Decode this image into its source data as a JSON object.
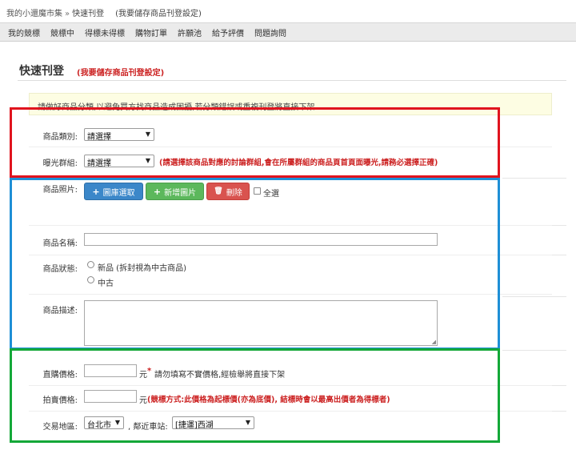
{
  "breadcrumb": {
    "home": "我的小還魔市集",
    "separator": "»",
    "current": "快速刊登",
    "sub": "(我要儲存商品刊登設定)"
  },
  "nav": {
    "items": [
      "我的競標",
      "競標中",
      "得標未得標",
      "購物訂單",
      "許願池",
      "給予評價",
      "問題詢問"
    ]
  },
  "page": {
    "title": "快速刊登",
    "subtitle": "(我要儲存商品刊登設定)",
    "notice": "請做好商品分類,以避免買方找商品造成困擾,若分類錯誤或重複刊登將直接下架"
  },
  "category": {
    "label": "商品類別:",
    "value": "請選擇"
  },
  "exposure": {
    "label": "曝光群組:",
    "value": "請選擇",
    "hint": "(請選擇該商品對應的討論群組,會在所屬群組的商品頁首頁面曝光,請務必選擇正確)"
  },
  "photos": {
    "label": "商品照片:",
    "gallery_button": "圖庫選取",
    "add_button": "新增圖片",
    "delete_button": "刪除",
    "select_all": "全選"
  },
  "name": {
    "label": "商品名稱:",
    "value": ""
  },
  "condition": {
    "label": "商品狀態:",
    "option_new": "新品 (拆封視為中古商品)",
    "option_used": "中古"
  },
  "description": {
    "label": "商品描述:",
    "value": ""
  },
  "buy_price": {
    "label": "直購價格:",
    "unit": "元",
    "asterisk": "*",
    "hint": "請勿填寫不實價格,經檢舉將直接下架"
  },
  "auction_price": {
    "label": "拍賣價格:",
    "unit": "元",
    "hint": "(競標方式:此價格為起標價(亦為底價), 結標時會以最高出價者為得標者)"
  },
  "location": {
    "label": "交易地區:",
    "city": "台北市",
    "station_label": ", 鄰近車站:",
    "station": "[捷運]西湖"
  },
  "icons": {
    "plus": "+",
    "trash": "🗑",
    "caret": "▼",
    "grip": "◢"
  },
  "colors": {
    "red_highlight": "#e0141e",
    "blue_highlight": "#1e8fd6",
    "green_highlight": "#14a838",
    "hint_red": "#cc2222"
  }
}
